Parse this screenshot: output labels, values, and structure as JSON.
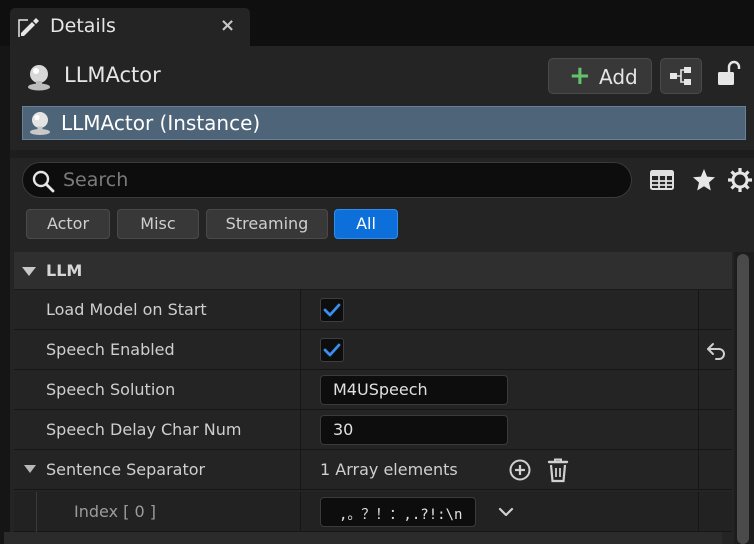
{
  "tab": {
    "title": "Details",
    "close": "×"
  },
  "actor": {
    "name": "LLMActor"
  },
  "toolbar": {
    "add_label": "Add",
    "add_plus": "+"
  },
  "instance": {
    "label": "LLMActor (Instance)"
  },
  "search": {
    "placeholder": "Search",
    "value": ""
  },
  "filters": [
    {
      "label": "Actor",
      "active": false
    },
    {
      "label": "Misc",
      "active": false
    },
    {
      "label": "Streaming",
      "active": false
    },
    {
      "label": "All",
      "active": true
    }
  ],
  "category": {
    "title": "LLM"
  },
  "properties": {
    "load_model": {
      "name": "Load Model on Start",
      "checked": true
    },
    "speech_enabled": {
      "name": "Speech Enabled",
      "checked": true
    },
    "speech_solution": {
      "name": "Speech Solution",
      "value": "M4USpeech"
    },
    "speech_delay": {
      "name": "Speech Delay Char Num",
      "value": "30"
    },
    "sentence_separator": {
      "name": "Sentence Separator",
      "count": "1 Array elements"
    },
    "index0": {
      "name": "Index [ 0 ]",
      "value": ",。？！：,.?!:\\n"
    }
  },
  "colors": {
    "accent": "#0d6fd9",
    "check": "#3a8ef0",
    "add_green": "#64c36a",
    "selected": "#4e6478"
  },
  "icons": [
    "pencil-icon",
    "close-icon",
    "actor-sphere-icon",
    "plus-icon",
    "blueprint-icon",
    "lock-icon",
    "search-icon",
    "table-icon",
    "star-icon",
    "gear-icon",
    "checkmark-icon",
    "reset-arrow-icon",
    "add-circle-icon",
    "trash-icon",
    "chevron-down-icon"
  ]
}
